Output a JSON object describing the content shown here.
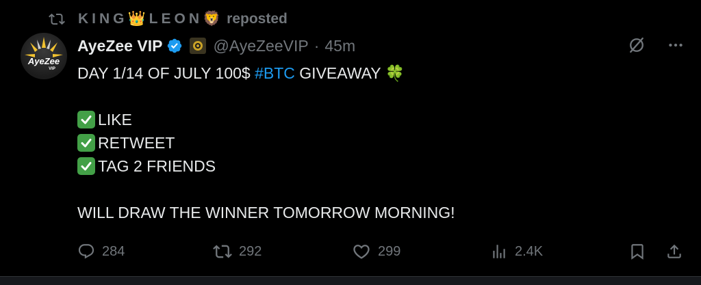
{
  "repost": {
    "icon": "repost-icon",
    "name_part1": "KING",
    "crown_emoji": "👑",
    "name_part2": "LEON",
    "lion_emoji": "🦁",
    "label": "reposted"
  },
  "author": {
    "avatar_text": "AyeZee",
    "avatar_subtext": "VIP",
    "display_name": "AyeZee VIP",
    "verified_icon": "verified-badge-icon",
    "affiliate_icon": "affiliate-badge-icon",
    "handle": "@AyeZeeVIP",
    "separator": "·",
    "time": "45m"
  },
  "header_actions": {
    "grok_icon": "grok-icon",
    "more_icon": "more-icon"
  },
  "tweet": {
    "line1_prefix": "DAY 1/14 OF JULY 100$ ",
    "hashtag": "#BTC",
    "line1_suffix": " GIVEAWAY ",
    "clover": "🍀",
    "items": [
      "LIKE",
      "RETWEET",
      "TAG 2 FRIENDS"
    ],
    "closing": "WILL DRAW THE WINNER TOMORROW MORNING!"
  },
  "actions": {
    "reply": {
      "icon": "reply-icon",
      "count": "284"
    },
    "retweet": {
      "icon": "retweet-icon",
      "count": "292"
    },
    "like": {
      "icon": "heart-icon",
      "count": "299"
    },
    "views": {
      "icon": "views-icon",
      "count": "2.4K"
    },
    "bookmark": {
      "icon": "bookmark-icon"
    },
    "share": {
      "icon": "share-icon"
    }
  },
  "colors": {
    "background": "#000000",
    "text": "#e7e9ea",
    "muted": "#71767b",
    "accent": "#1d9bf0",
    "check": "#43a047"
  }
}
